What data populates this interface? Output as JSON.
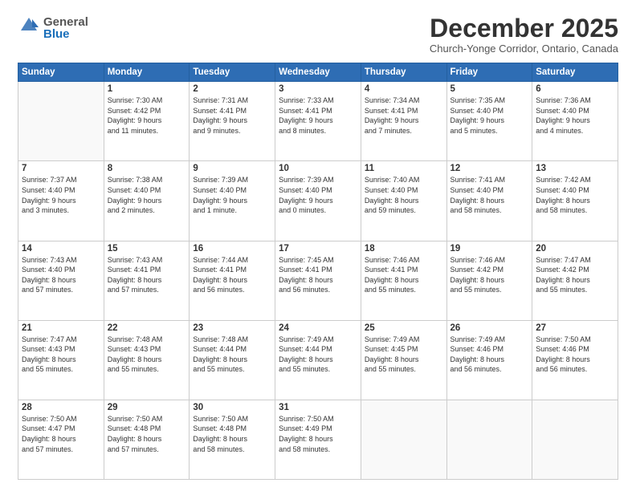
{
  "header": {
    "logo_line1": "General",
    "logo_line2": "Blue",
    "month": "December 2025",
    "location": "Church-Yonge Corridor, Ontario, Canada"
  },
  "weekdays": [
    "Sunday",
    "Monday",
    "Tuesday",
    "Wednesday",
    "Thursday",
    "Friday",
    "Saturday"
  ],
  "weeks": [
    [
      {
        "day": "",
        "info": ""
      },
      {
        "day": "1",
        "info": "Sunrise: 7:30 AM\nSunset: 4:42 PM\nDaylight: 9 hours\nand 11 minutes."
      },
      {
        "day": "2",
        "info": "Sunrise: 7:31 AM\nSunset: 4:41 PM\nDaylight: 9 hours\nand 9 minutes."
      },
      {
        "day": "3",
        "info": "Sunrise: 7:33 AM\nSunset: 4:41 PM\nDaylight: 9 hours\nand 8 minutes."
      },
      {
        "day": "4",
        "info": "Sunrise: 7:34 AM\nSunset: 4:41 PM\nDaylight: 9 hours\nand 7 minutes."
      },
      {
        "day": "5",
        "info": "Sunrise: 7:35 AM\nSunset: 4:40 PM\nDaylight: 9 hours\nand 5 minutes."
      },
      {
        "day": "6",
        "info": "Sunrise: 7:36 AM\nSunset: 4:40 PM\nDaylight: 9 hours\nand 4 minutes."
      }
    ],
    [
      {
        "day": "7",
        "info": "Sunrise: 7:37 AM\nSunset: 4:40 PM\nDaylight: 9 hours\nand 3 minutes."
      },
      {
        "day": "8",
        "info": "Sunrise: 7:38 AM\nSunset: 4:40 PM\nDaylight: 9 hours\nand 2 minutes."
      },
      {
        "day": "9",
        "info": "Sunrise: 7:39 AM\nSunset: 4:40 PM\nDaylight: 9 hours\nand 1 minute."
      },
      {
        "day": "10",
        "info": "Sunrise: 7:39 AM\nSunset: 4:40 PM\nDaylight: 9 hours\nand 0 minutes."
      },
      {
        "day": "11",
        "info": "Sunrise: 7:40 AM\nSunset: 4:40 PM\nDaylight: 8 hours\nand 59 minutes."
      },
      {
        "day": "12",
        "info": "Sunrise: 7:41 AM\nSunset: 4:40 PM\nDaylight: 8 hours\nand 58 minutes."
      },
      {
        "day": "13",
        "info": "Sunrise: 7:42 AM\nSunset: 4:40 PM\nDaylight: 8 hours\nand 58 minutes."
      }
    ],
    [
      {
        "day": "14",
        "info": "Sunrise: 7:43 AM\nSunset: 4:40 PM\nDaylight: 8 hours\nand 57 minutes."
      },
      {
        "day": "15",
        "info": "Sunrise: 7:43 AM\nSunset: 4:41 PM\nDaylight: 8 hours\nand 57 minutes."
      },
      {
        "day": "16",
        "info": "Sunrise: 7:44 AM\nSunset: 4:41 PM\nDaylight: 8 hours\nand 56 minutes."
      },
      {
        "day": "17",
        "info": "Sunrise: 7:45 AM\nSunset: 4:41 PM\nDaylight: 8 hours\nand 56 minutes."
      },
      {
        "day": "18",
        "info": "Sunrise: 7:46 AM\nSunset: 4:41 PM\nDaylight: 8 hours\nand 55 minutes."
      },
      {
        "day": "19",
        "info": "Sunrise: 7:46 AM\nSunset: 4:42 PM\nDaylight: 8 hours\nand 55 minutes."
      },
      {
        "day": "20",
        "info": "Sunrise: 7:47 AM\nSunset: 4:42 PM\nDaylight: 8 hours\nand 55 minutes."
      }
    ],
    [
      {
        "day": "21",
        "info": "Sunrise: 7:47 AM\nSunset: 4:43 PM\nDaylight: 8 hours\nand 55 minutes."
      },
      {
        "day": "22",
        "info": "Sunrise: 7:48 AM\nSunset: 4:43 PM\nDaylight: 8 hours\nand 55 minutes."
      },
      {
        "day": "23",
        "info": "Sunrise: 7:48 AM\nSunset: 4:44 PM\nDaylight: 8 hours\nand 55 minutes."
      },
      {
        "day": "24",
        "info": "Sunrise: 7:49 AM\nSunset: 4:44 PM\nDaylight: 8 hours\nand 55 minutes."
      },
      {
        "day": "25",
        "info": "Sunrise: 7:49 AM\nSunset: 4:45 PM\nDaylight: 8 hours\nand 55 minutes."
      },
      {
        "day": "26",
        "info": "Sunrise: 7:49 AM\nSunset: 4:46 PM\nDaylight: 8 hours\nand 56 minutes."
      },
      {
        "day": "27",
        "info": "Sunrise: 7:50 AM\nSunset: 4:46 PM\nDaylight: 8 hours\nand 56 minutes."
      }
    ],
    [
      {
        "day": "28",
        "info": "Sunrise: 7:50 AM\nSunset: 4:47 PM\nDaylight: 8 hours\nand 57 minutes."
      },
      {
        "day": "29",
        "info": "Sunrise: 7:50 AM\nSunset: 4:48 PM\nDaylight: 8 hours\nand 57 minutes."
      },
      {
        "day": "30",
        "info": "Sunrise: 7:50 AM\nSunset: 4:48 PM\nDaylight: 8 hours\nand 58 minutes."
      },
      {
        "day": "31",
        "info": "Sunrise: 7:50 AM\nSunset: 4:49 PM\nDaylight: 8 hours\nand 58 minutes."
      },
      {
        "day": "",
        "info": ""
      },
      {
        "day": "",
        "info": ""
      },
      {
        "day": "",
        "info": ""
      }
    ]
  ]
}
